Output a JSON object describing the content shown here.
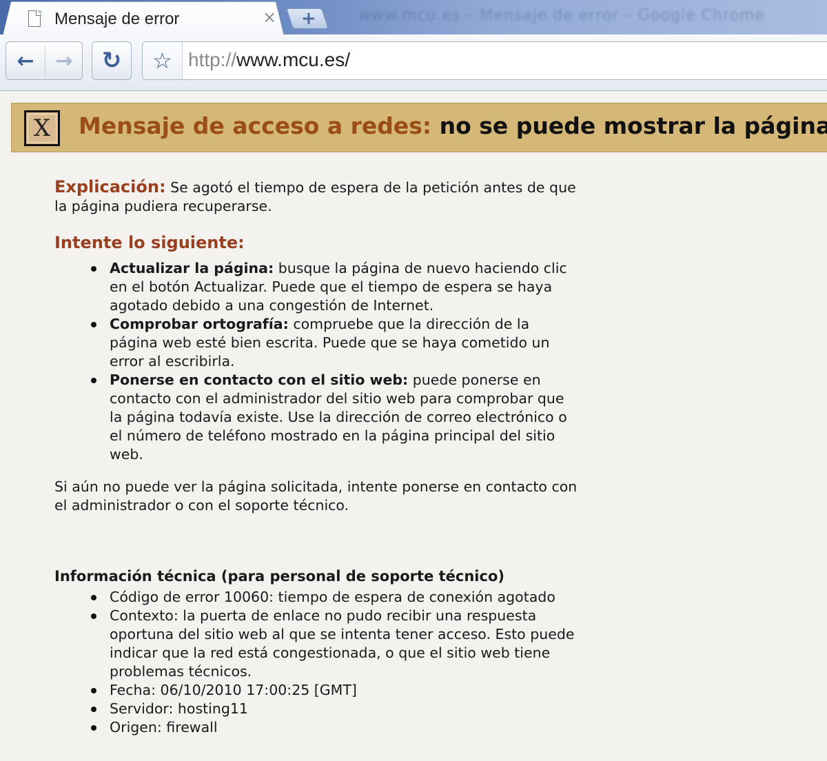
{
  "browser": {
    "tab_title": "Mensaje de error",
    "tab_close": "×",
    "new_tab": "+",
    "url_scheme": "http://",
    "url_host": "www.mcu.es/",
    "background_window_text": "www.mcu.es – Mensaje de error – Google Chrome"
  },
  "banner": {
    "icon_letter": "X",
    "title_prefix": "Mensaje de acceso a redes:",
    "title_suffix": "no se puede mostrar la página",
    "background_color": "#d5b878"
  },
  "explanation": {
    "label": "Explicación:",
    "text": "Se agotó el tiempo de espera de la petición antes de que la página pudiera recuperarse."
  },
  "try": {
    "heading": "Intente lo siguiente:",
    "items": [
      {
        "bold": "Actualizar la página:",
        "text": "busque la página de nuevo haciendo clic en el botón Actualizar. Puede que el tiempo de espera se haya agotado debido a una congestión de Internet."
      },
      {
        "bold": "Comprobar ortografía:",
        "text": "compruebe que la dirección de la página web esté bien escrita. Puede que se haya cometido un error al escribirla."
      },
      {
        "bold": "Ponerse en contacto con el sitio web:",
        "text": "puede ponerse en contacto con el administrador del sitio web para comprobar que la página todavía existe. Use la dirección de correo electrónico o el número de teléfono mostrado en la página principal del sitio web."
      }
    ]
  },
  "closing": "Si aún no puede ver la página solicitada, intente ponerse en contacto con el administrador o con el soporte técnico.",
  "tech": {
    "heading": "Información técnica (para personal de soporte técnico)",
    "items": [
      "Código de error 10060: tiempo de espera de conexión agotado",
      "Contexto: la puerta de enlace no pudo recibir una respuesta oportuna del sitio web al que se intenta tener acceso. Esto puede indicar que la red está congestionada, o que el sitio web tiene problemas técnicos.",
      "Fecha: 06/10/2010 17:00:25 [GMT]",
      "Servidor: hosting11",
      "Origen: firewall"
    ]
  },
  "icons": {
    "back": "back-arrow-icon",
    "forward": "forward-arrow-icon",
    "reload": "reload-icon",
    "bookmark": "star-icon",
    "page": "page-icon",
    "error": "error-x-icon"
  }
}
